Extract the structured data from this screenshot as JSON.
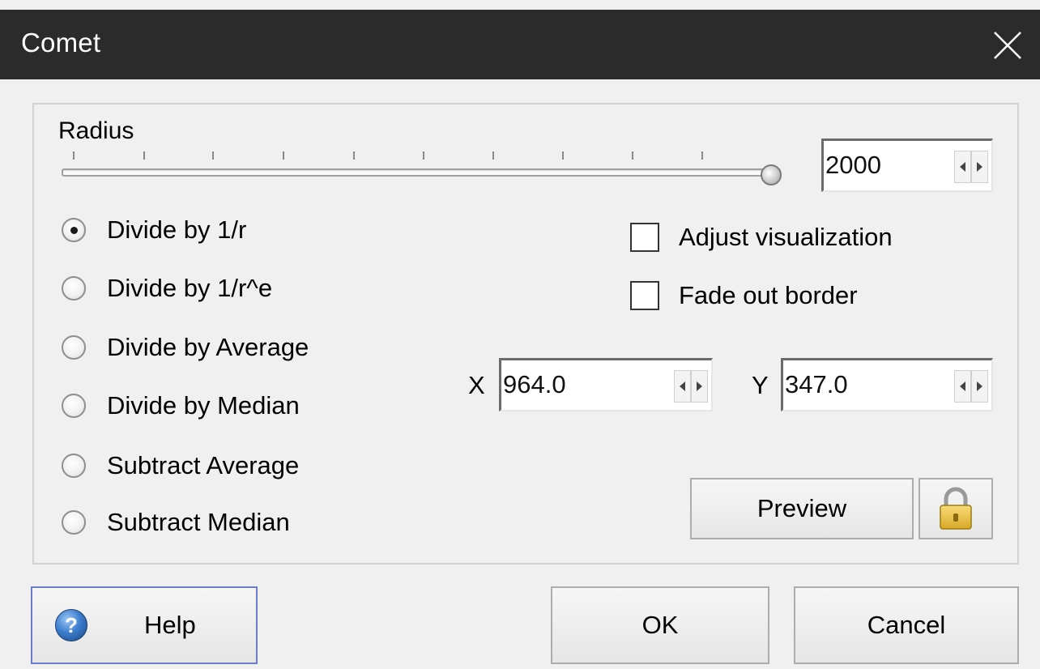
{
  "window": {
    "title": "Comet"
  },
  "radius": {
    "label": "Radius",
    "value": "2000",
    "slider_fraction": 1.0
  },
  "options": [
    {
      "label": "Divide by 1/r",
      "checked": true
    },
    {
      "label": "Divide by 1/r^e",
      "checked": false
    },
    {
      "label": "Divide by Average",
      "checked": false
    },
    {
      "label": "Divide by Median",
      "checked": false
    },
    {
      "label": "Subtract Average",
      "checked": false
    },
    {
      "label": "Subtract Median",
      "checked": false
    }
  ],
  "checkboxes": [
    {
      "label": "Adjust visualization",
      "checked": false
    },
    {
      "label": "Fade out border",
      "checked": false
    }
  ],
  "coords": {
    "x_label": "X",
    "x_value": "964.0",
    "y_label": "Y",
    "y_value": "347.0"
  },
  "buttons": {
    "preview": "Preview",
    "help": "Help",
    "ok": "OK",
    "cancel": "Cancel"
  },
  "icons": {
    "close": "close-icon",
    "help": "help-icon",
    "lock": "lock-icon"
  },
  "colors": {
    "titlebar": "#2b2b2b",
    "background": "#f0f0f0",
    "help_border": "#6e7ccf"
  }
}
